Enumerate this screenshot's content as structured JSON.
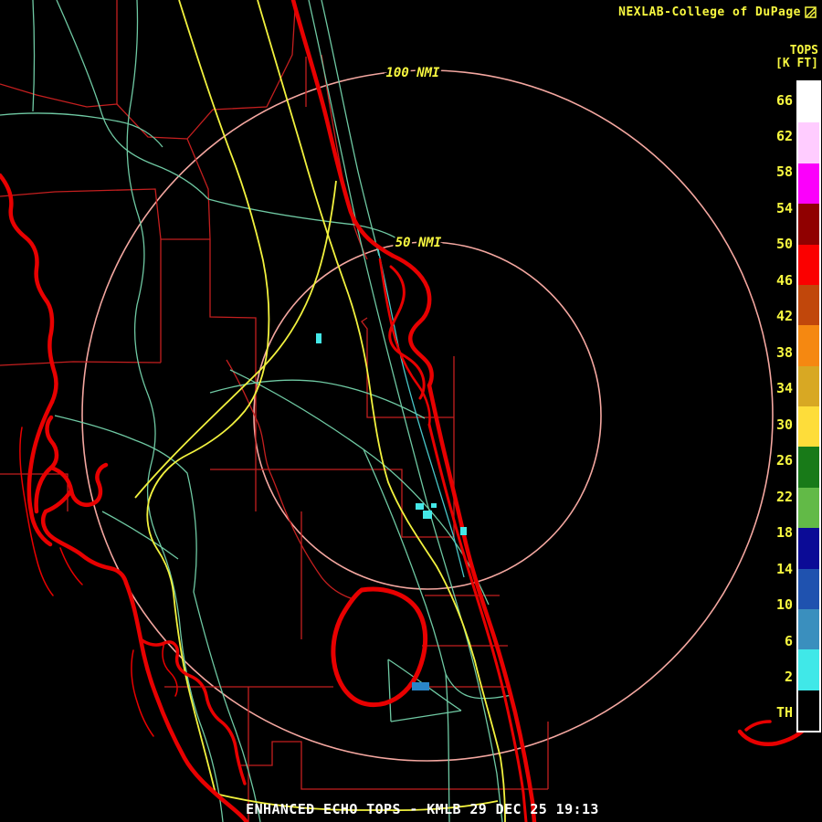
{
  "header": {
    "attribution": "NEXLAB-College of DuPage",
    "logo_icon": "cod-logo"
  },
  "legend": {
    "title_line1": "TOPS",
    "title_line2": "[K FT]",
    "labels": [
      "66",
      "62",
      "58",
      "54",
      "50",
      "46",
      "42",
      "38",
      "34",
      "30",
      "26",
      "22",
      "18",
      "14",
      "10",
      "6",
      "2",
      "TH"
    ],
    "band_colors": [
      "#ffffff",
      "#ffccff",
      "#fb00fb",
      "#900000",
      "#fb0000",
      "#c1470b",
      "#f58811",
      "#d8a823",
      "#fedd3a",
      "#187a18",
      "#62ba47",
      "#0b0b96",
      "#1f52af",
      "#3a8fbe",
      "#40e8e8",
      "#000000"
    ]
  },
  "rings": [
    {
      "label": "100 NMI",
      "radius_nmi": 100
    },
    {
      "label": "50 NMI",
      "radius_nmi": 50
    }
  ],
  "footer": {
    "product_title": "ENHANCED ECHO TOPS - KMLB 29 DEC 25 19:13"
  },
  "echoes": [
    {
      "value_kft": 2,
      "color": "#44e8e8",
      "note": "small cyan echo cells inland and near coast"
    },
    {
      "value_kft": 10,
      "color": "#2a86c8",
      "note": "small blue echo cell southeast of Lake Okeechobee"
    }
  ],
  "colors": {
    "text_yellow": "#f8f840",
    "title_white": "#ffffff",
    "range_ring": "#f4a7a0",
    "coastline": "#e80000",
    "county_line": "#c41f1f",
    "road": "#6fc9a3",
    "interstate": "#f2f23e",
    "waterway": "#49c6c8",
    "echo_low": "#44e8e8",
    "echo_mid": "#2a86c8"
  }
}
